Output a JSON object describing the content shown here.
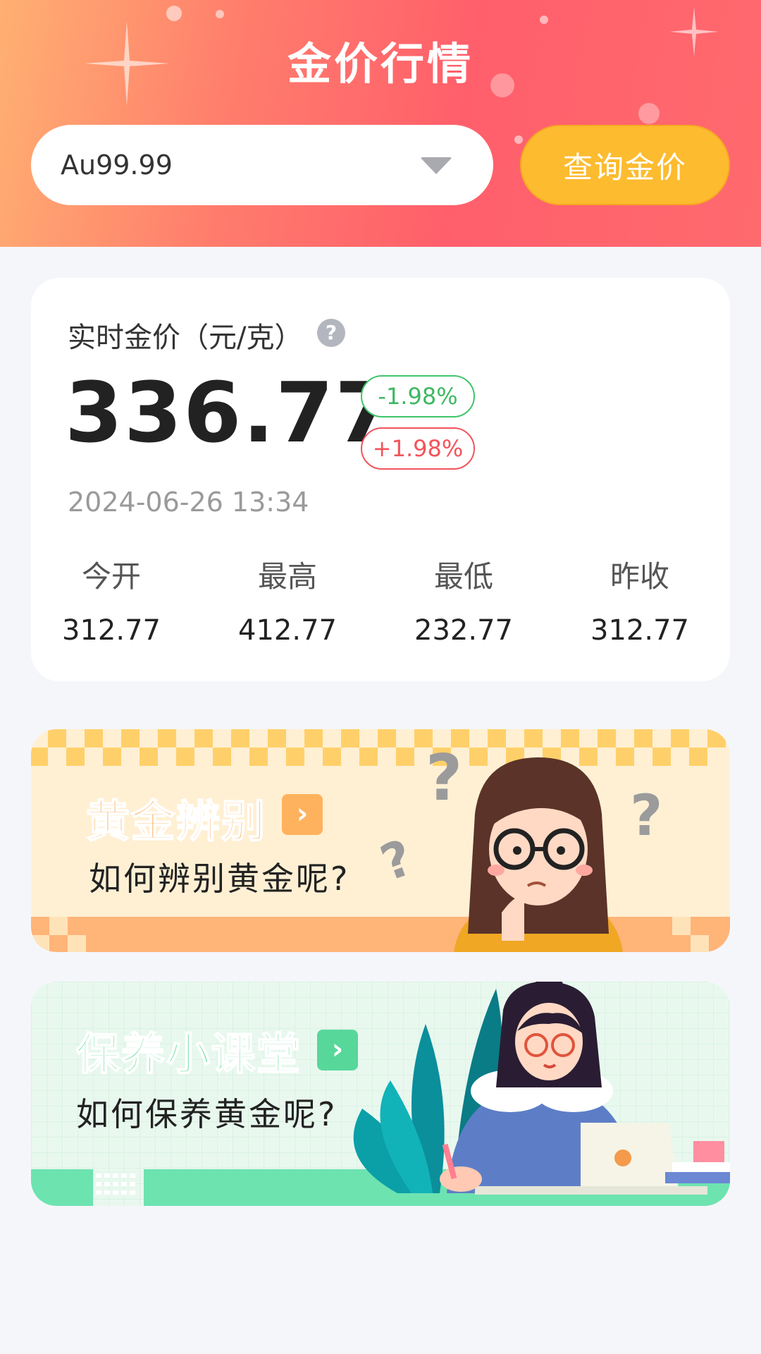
{
  "header": {
    "title": "金价行情",
    "select_value": "Au99.99",
    "query_button": "查询金价"
  },
  "realtime": {
    "label": "实时金价（元/克）",
    "help": "?",
    "price": "336.77",
    "change_down": "-1.98%",
    "change_up": "+1.98%",
    "timestamp": "2024-06-26 13:34",
    "stats": [
      {
        "label": "今开",
        "value": "312.77"
      },
      {
        "label": "最高",
        "value": "412.77"
      },
      {
        "label": "最低",
        "value": "232.77"
      },
      {
        "label": "昨收",
        "value": "312.77"
      }
    ]
  },
  "banners": [
    {
      "title": "黄金辨别",
      "subtitle": "如何辨别黄金呢?",
      "arrow": "›"
    },
    {
      "title": "保养小课堂",
      "subtitle": "如何保养黄金呢?",
      "arrow": "›"
    }
  ],
  "colors": {
    "header_gradient_start": "#ffb072",
    "header_gradient_end": "#ff5f6b",
    "query_button": "#fdbb2f",
    "down": "#3fb863",
    "up": "#f2545b"
  }
}
